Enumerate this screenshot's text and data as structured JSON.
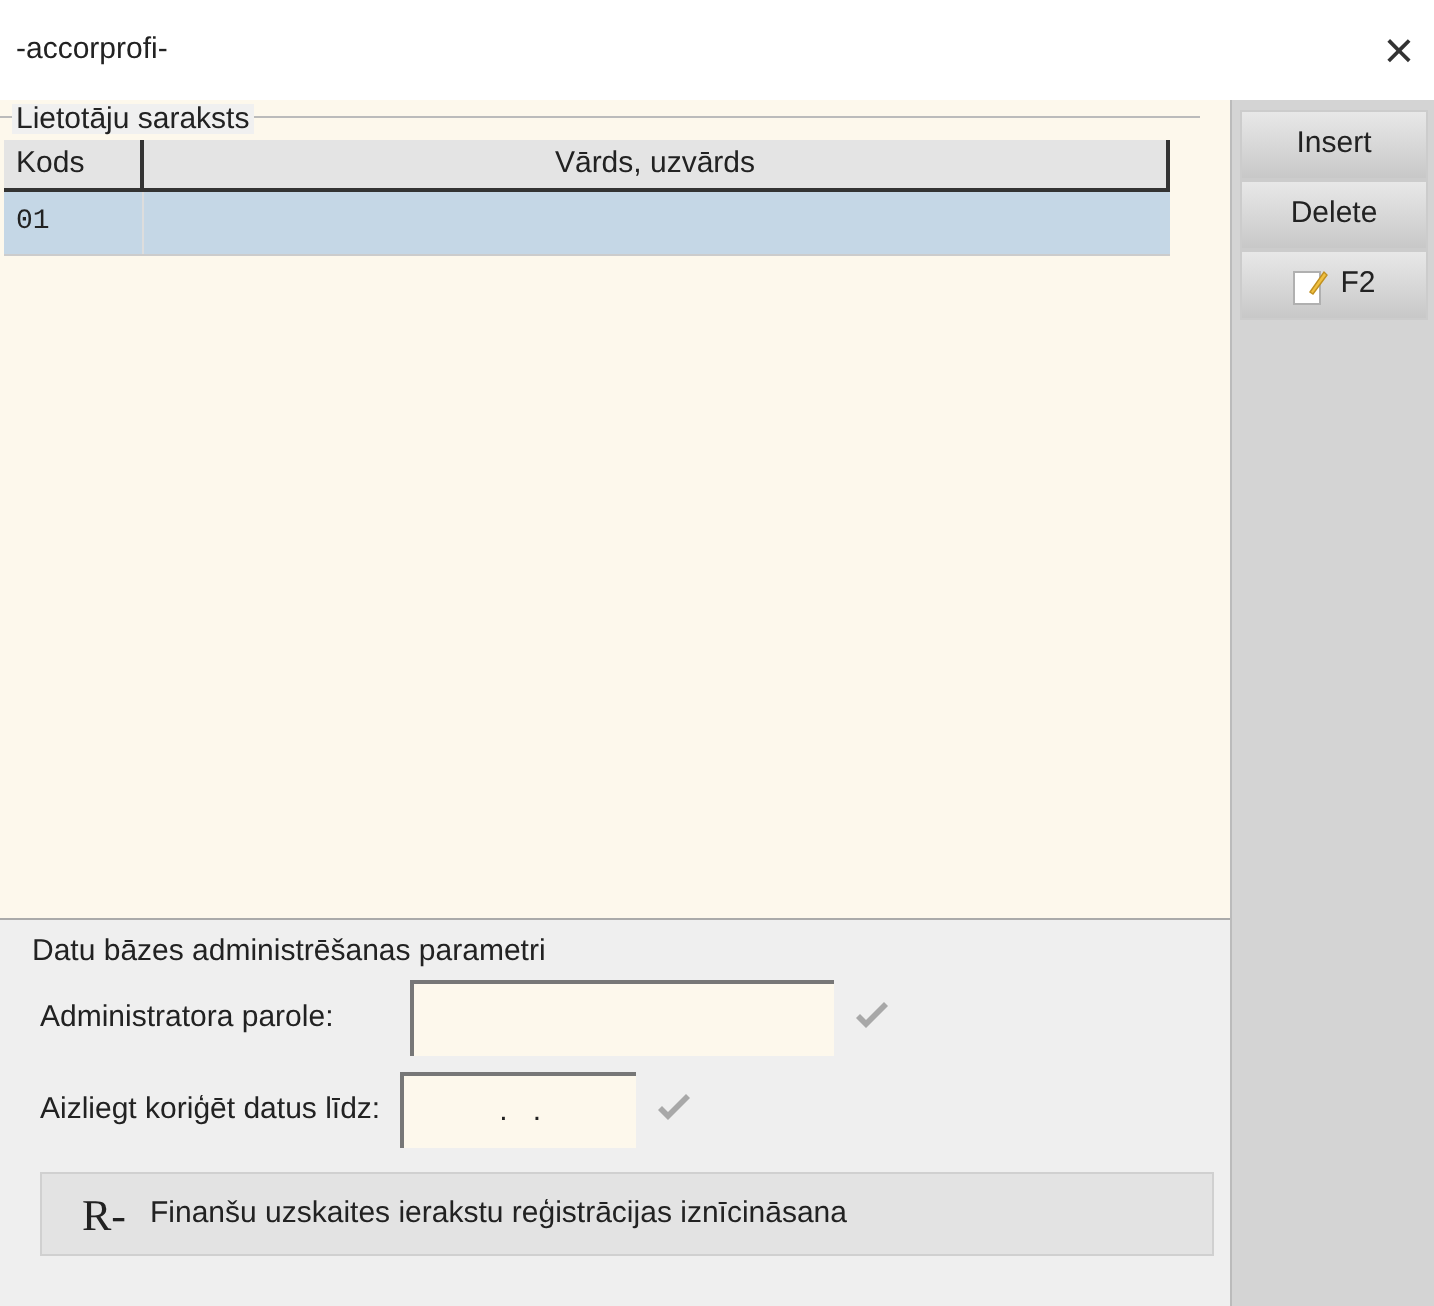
{
  "window": {
    "title": "-accorprofi-",
    "close": "×"
  },
  "users": {
    "legend": "Lietotāju saraksts",
    "columns": [
      "Kods",
      "Vārds, uzvārds"
    ],
    "rows": [
      {
        "cells": [
          "01",
          ""
        ],
        "selected": true
      }
    ]
  },
  "admin": {
    "legend": "Datu bāzes administrēšanas parametri",
    "fields": [
      {
        "label": "Administratora parole:",
        "kind": "text"
      },
      {
        "label": "Aizliegt koriģēt datus līdz:",
        "value": ".   .",
        "kind": "date"
      }
    ],
    "action": {
      "glyph": "R-",
      "label": "Finanšu uzskaites ierakstu reģistrācijas iznīcināsana"
    }
  },
  "buttons": [
    {
      "label": "Insert",
      "kind": "plain"
    },
    {
      "label": "Delete",
      "kind": "plain"
    },
    {
      "label": "F2",
      "kind": "icon"
    }
  ]
}
